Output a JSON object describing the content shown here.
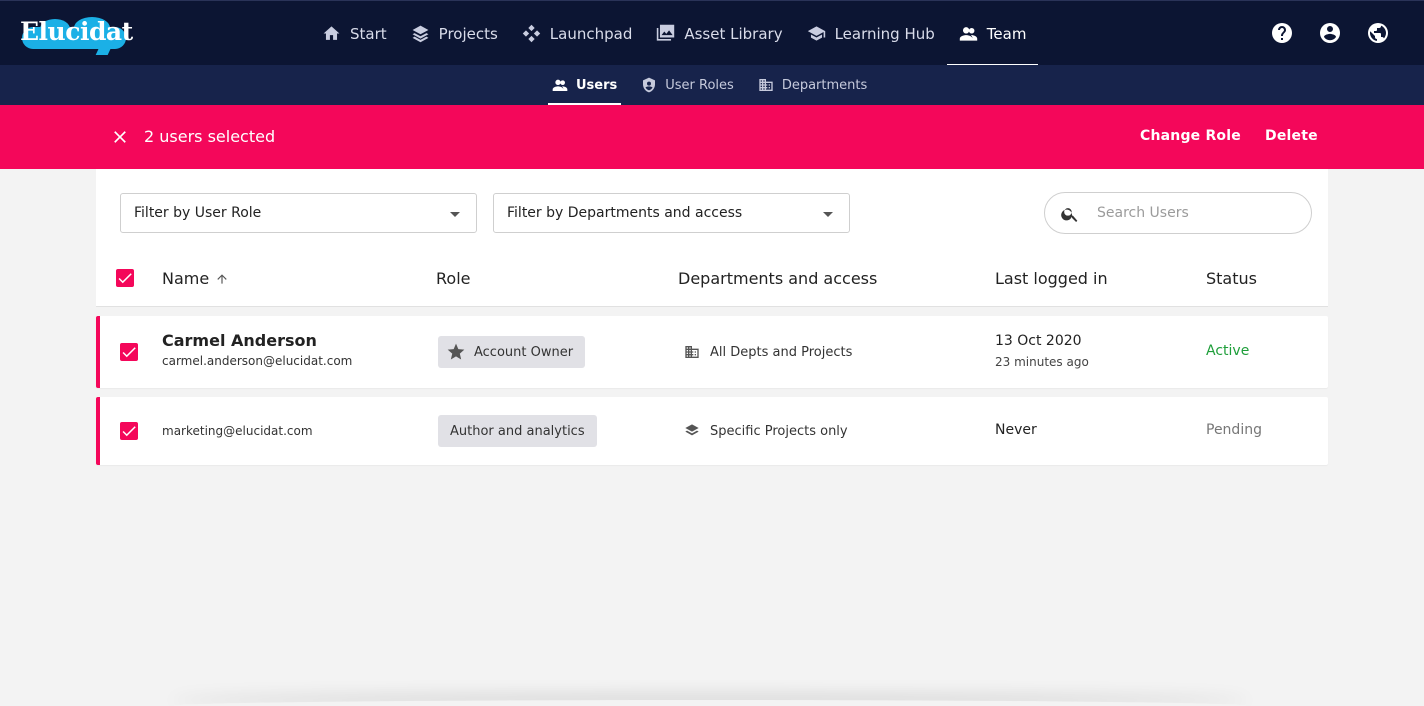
{
  "brand": {
    "name": "Elucidat"
  },
  "nav": {
    "items": [
      {
        "label": "Start",
        "icon": "home-icon"
      },
      {
        "label": "Projects",
        "icon": "layers-icon"
      },
      {
        "label": "Launchpad",
        "icon": "launchpad-icon"
      },
      {
        "label": "Asset Library",
        "icon": "images-icon"
      },
      {
        "label": "Learning Hub",
        "icon": "graduation-cap-icon"
      },
      {
        "label": "Team",
        "icon": "people-icon",
        "active": true
      }
    ],
    "right_icons": [
      "help-icon",
      "account-icon",
      "globe-icon"
    ]
  },
  "subnav": {
    "items": [
      {
        "label": "Users",
        "icon": "people-icon",
        "active": true
      },
      {
        "label": "User Roles",
        "icon": "shield-icon"
      },
      {
        "label": "Departments",
        "icon": "building-icon"
      }
    ]
  },
  "selection_bar": {
    "count_text": "2 users selected",
    "change_role": "Change Role",
    "delete": "Delete",
    "color": "#f4075a"
  },
  "filters": {
    "user_role": "Filter by User Role",
    "departments": "Filter by Departments and access",
    "search_placeholder": "Search Users"
  },
  "table": {
    "headers": {
      "name": "Name",
      "role": "Role",
      "departments": "Departments and access",
      "last_logged_in": "Last logged in",
      "status": "Status"
    },
    "rows": [
      {
        "name": "Carmel Anderson",
        "email": "carmel.anderson@elucidat.com",
        "role": "Account Owner",
        "role_icon": "star-icon",
        "departments": "All Depts and Projects",
        "dept_icon": "building-icon",
        "last_logged_in": "13 Oct 2020",
        "last_logged_ago": "23 minutes ago",
        "status": "Active",
        "status_color": "#1e9e3a",
        "selected": true
      },
      {
        "name": "",
        "email": "marketing@elucidat.com",
        "role": "Author and analytics",
        "role_icon": "",
        "departments": "Specific Projects only",
        "dept_icon": "layers-icon",
        "last_logged_in": "Never",
        "last_logged_ago": "",
        "status": "Pending",
        "status_color": "#777777",
        "selected": true
      }
    ]
  },
  "colors": {
    "nav_bg": "#0c1533",
    "subnav_bg": "#17234b",
    "accent": "#f4075a"
  }
}
